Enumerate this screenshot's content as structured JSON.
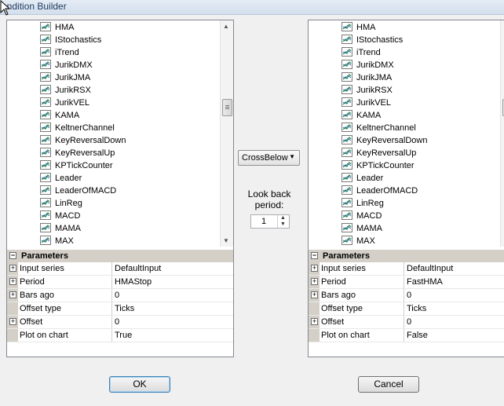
{
  "window": {
    "title": "ondition Builder"
  },
  "left": {
    "indicators": [
      "HMA",
      "IStochastics",
      "iTrend",
      "JurikDMX",
      "JurikJMA",
      "JurikRSX",
      "JurikVEL",
      "KAMA",
      "KeltnerChannel",
      "KeyReversalDown",
      "KeyReversalUp",
      "KPTickCounter",
      "Leader",
      "LeaderOfMACD",
      "LinReg",
      "MACD",
      "MAMA",
      "MAX"
    ],
    "parameters_header": "Parameters",
    "parameters": [
      {
        "name": "Input series",
        "value": "DefaultInput",
        "expand": "+"
      },
      {
        "name": "Period",
        "value": "HMAStop",
        "expand": "+"
      },
      {
        "name": "Bars ago",
        "value": "0",
        "expand": "+"
      },
      {
        "name": "Offset type",
        "value": "Ticks",
        "expand": ""
      },
      {
        "name": "Offset",
        "value": "0",
        "expand": "+"
      },
      {
        "name": "Plot on chart",
        "value": "True",
        "expand": ""
      }
    ]
  },
  "right": {
    "indicators": [
      "HMA",
      "IStochastics",
      "iTrend",
      "JurikDMX",
      "JurikJMA",
      "JurikRSX",
      "JurikVEL",
      "KAMA",
      "KeltnerChannel",
      "KeyReversalDown",
      "KeyReversalUp",
      "KPTickCounter",
      "Leader",
      "LeaderOfMACD",
      "LinReg",
      "MACD",
      "MAMA",
      "MAX"
    ],
    "parameters_header": "Parameters",
    "parameters": [
      {
        "name": "Input series",
        "value": "DefaultInput",
        "expand": "+"
      },
      {
        "name": "Period",
        "value": "FastHMA",
        "expand": "+"
      },
      {
        "name": "Bars ago",
        "value": "0",
        "expand": "+"
      },
      {
        "name": "Offset type",
        "value": "Ticks",
        "expand": ""
      },
      {
        "name": "Offset",
        "value": "0",
        "expand": "+"
      },
      {
        "name": "Plot on chart",
        "value": "False",
        "expand": ""
      }
    ]
  },
  "condition": {
    "selected": "CrossBelow"
  },
  "lookback": {
    "label": "Look back period:",
    "value": "1"
  },
  "buttons": {
    "ok": "OK",
    "cancel": "Cancel"
  },
  "icons": {
    "indicator": "indicator-chart-icon",
    "scroll_up": "scroll-up-arrow-icon",
    "scroll_down": "scroll-down-arrow-icon",
    "dropdown": "chevron-down-icon",
    "expand": "expand-plus-icon",
    "collapse": "collapse-minus-icon"
  }
}
